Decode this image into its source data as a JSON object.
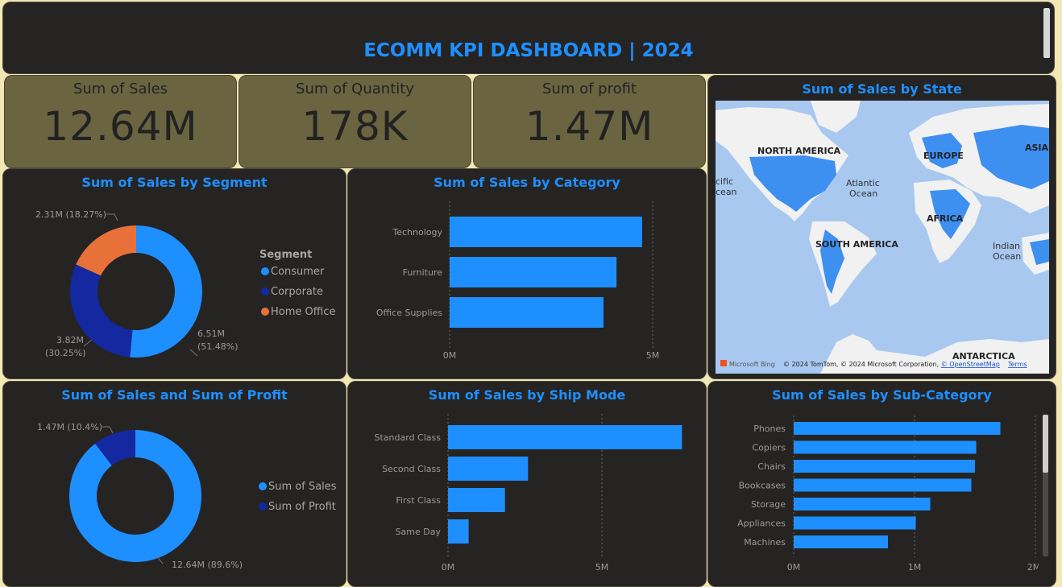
{
  "header": {
    "title": "ECOMM KPI DASHBOARD | 2024"
  },
  "colors": {
    "accent": "#1e8fff",
    "consumer": "#1e8fff",
    "corporate": "#1428a0",
    "home_office": "#e8713a",
    "kpi_bg": "#6b6441",
    "panel_bg": "#252423",
    "page_bg": "#f3e8b4"
  },
  "kpis": [
    {
      "label": "Sum of Sales",
      "value": "12.64M"
    },
    {
      "label": "Sum of Quantity",
      "value": "178K"
    },
    {
      "label": "Sum of profit",
      "value": "1.47M"
    }
  ],
  "map": {
    "title": "Sum of Sales by State",
    "labels": [
      "NORTH AMERICA",
      "EUROPE",
      "ASIA",
      "Atlantic",
      "Ocean",
      "cific",
      "cean",
      "AFRICA",
      "SOUTH AMERICA",
      "Indian",
      "Ocean",
      "ANTARCTICA"
    ],
    "bing": "Microsoft Bing",
    "attribution_text": "© 2024 TomTom, © 2024 Microsoft Corporation, ",
    "attribution_link": "© OpenStreetMap",
    "terms": "Terms"
  },
  "charts": {
    "segment": {
      "title": "Sum of Sales by Segment",
      "legend_title": "Segment",
      "labels": {
        "consumer_line1": "6.51M",
        "consumer_line2": "(51.48%)",
        "corporate_line1": "3.82M",
        "corporate_line2": "(30.25%)",
        "home_office": "2.31M (18.27%)"
      }
    },
    "category": {
      "title": "Sum of Sales by Category",
      "ticks": [
        "0M",
        "5M"
      ]
    },
    "profit": {
      "title": "Sum of Sales and Sum of Profit",
      "labels": {
        "sales": "12.64M (89.6%)",
        "profit": "1.47M (10.4%)"
      }
    },
    "shipmode": {
      "title": "Sum of Sales by Ship Mode",
      "ticks": [
        "0M",
        "5M"
      ]
    },
    "subcategory": {
      "title": "Sum of Sales by Sub-Category",
      "ticks": [
        "0M",
        "1M",
        "2M"
      ]
    }
  },
  "chart_data": [
    {
      "type": "pie",
      "title": "Sum of Sales by Segment",
      "legend": "right",
      "categories": [
        "Consumer",
        "Corporate",
        "Home Office"
      ],
      "values": [
        6.51,
        3.82,
        2.31
      ],
      "percent": [
        51.48,
        30.25,
        18.27
      ]
    },
    {
      "type": "bar",
      "title": "Sum of Sales by Category",
      "orientation": "horizontal",
      "categories": [
        "Technology",
        "Furniture",
        "Office Supplies"
      ],
      "values": [
        4.74,
        4.11,
        3.79
      ],
      "xlim": [
        0,
        5.5
      ]
    },
    {
      "type": "pie",
      "title": "Sum of Sales and Sum of Profit",
      "legend": "right",
      "categories": [
        "Sum of Sales",
        "Sum of Profit"
      ],
      "values": [
        12.64,
        1.47
      ],
      "percent": [
        89.6,
        10.4
      ]
    },
    {
      "type": "bar",
      "title": "Sum of Sales by Ship Mode",
      "orientation": "horizontal",
      "categories": [
        "Standard Class",
        "Second Class",
        "First Class",
        "Same Day"
      ],
      "values": [
        7.6,
        2.6,
        1.85,
        0.67
      ],
      "xlim": [
        0,
        7.6
      ]
    },
    {
      "type": "bar",
      "title": "Sum of Sales by Sub-Category",
      "orientation": "horizontal",
      "categories": [
        "Phones",
        "Copiers",
        "Chairs",
        "Bookcases",
        "Storage",
        "Appliances",
        "Machines"
      ],
      "values": [
        1.71,
        1.51,
        1.5,
        1.47,
        1.13,
        1.01,
        0.78
      ],
      "xlim": [
        0,
        2
      ]
    }
  ]
}
